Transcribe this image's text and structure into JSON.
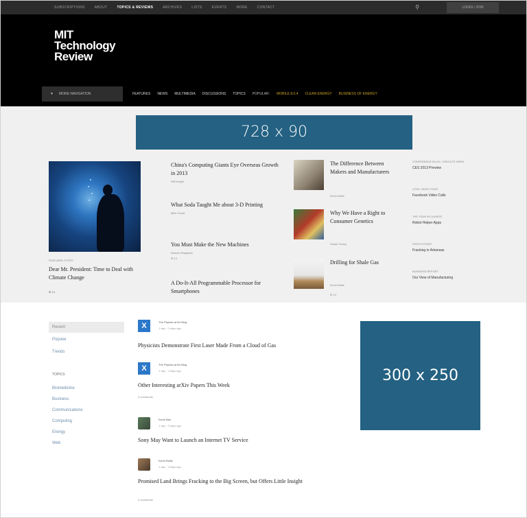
{
  "topbar": {
    "nav": [
      "Subscriptions",
      "About",
      "Topics & Reviews",
      "Archives",
      "Lists",
      "Events",
      "More",
      "Contact"
    ],
    "active_index": 2,
    "search_icon": "search-icon",
    "login_label": "Login / Join"
  },
  "logo": {
    "line1": "MIT",
    "line2": "Technology",
    "line3": "Review"
  },
  "mainnav": {
    "menu_label": "More Navigation",
    "items": [
      "Features",
      "News",
      "Multimedia",
      "Discussions",
      "Topics"
    ],
    "popular_label": "Popular:",
    "popular_items": [
      "Mobile 8.0.4",
      "Clean Energy",
      "Business of Energy"
    ]
  },
  "ads": {
    "leaderboard": "728 x 90",
    "rectangle": "300 x 250"
  },
  "hero": {
    "kicker": "Featured Story",
    "title": "Dear Mr. President: Time to Deal with Climate Change",
    "meta": "✉ 14"
  },
  "col2": [
    {
      "title": "China's Computing Giants Eye Overseas Growth in 2013",
      "meta": "Will Knight"
    },
    {
      "title": "What Soda Taught Me about 3-D Printing",
      "meta": "Mike Orcutt"
    },
    {
      "title": "You Must Make the New Machines",
      "meta": "Antonio Regalado",
      "extra": "✉ 14"
    },
    {
      "title": "A Do-It-All Programmable Processor for Smartphones",
      "meta": ""
    }
  ],
  "col3": [
    {
      "title": "The Difference Between Makers and Manufacturers",
      "meta": "Kevin Bullis"
    },
    {
      "title": "Why We Have a Right to Consumer Genetics",
      "meta": "Susan Young"
    },
    {
      "title": "Drilling for Shale Gas",
      "meta": "Kevin Bullis",
      "extra": "✉ 14"
    }
  ],
  "col4": [
    {
      "label": "Conference Blog / Circuits Week",
      "text": "CES 2013 Preview"
    },
    {
      "label": "Cool Video Tour",
      "text": "Facebook Video Calls"
    },
    {
      "label": "The Year in Climate",
      "text": "Robot Helper Apps"
    },
    {
      "label": "Photo Essay",
      "text": "Fracking in Arkansas"
    },
    {
      "label": "Business Report",
      "text": "Our View of Manufacturing"
    }
  ],
  "sidenav": {
    "filters": [
      "Recent",
      "Popular",
      "Trends"
    ],
    "topics_heading": "Topics",
    "topics": [
      "Biomedicine",
      "Business",
      "Communications",
      "Computing",
      "Energy",
      "Web"
    ]
  },
  "feed": [
    {
      "author": "The Physics arXiv Blog",
      "meta": "1 day · 2 days ago",
      "title": "Physicists Demonstrate First Laser Made From a Cloud of Gas",
      "comments": "",
      "avatar": "X"
    },
    {
      "author": "The Physics arXiv Blog",
      "meta": "1 day · 2 days ago",
      "title": "Other Interesting arXiv Papers This Week",
      "comments": "3 comments",
      "avatar": "X"
    },
    {
      "author": "Kevin Bee",
      "meta": "1 day · 3 days ago",
      "title": "Sony May Want to Launch an Internet TV Service",
      "comments": "",
      "avatar": "photo"
    },
    {
      "author": "Kevin Bullis",
      "meta": "1 day · 3 days ago",
      "title": "Promised Land Brings Fracking to the Big Screen, but Offers Little Insight",
      "comments": "3 comments",
      "avatar": "photo"
    }
  ]
}
